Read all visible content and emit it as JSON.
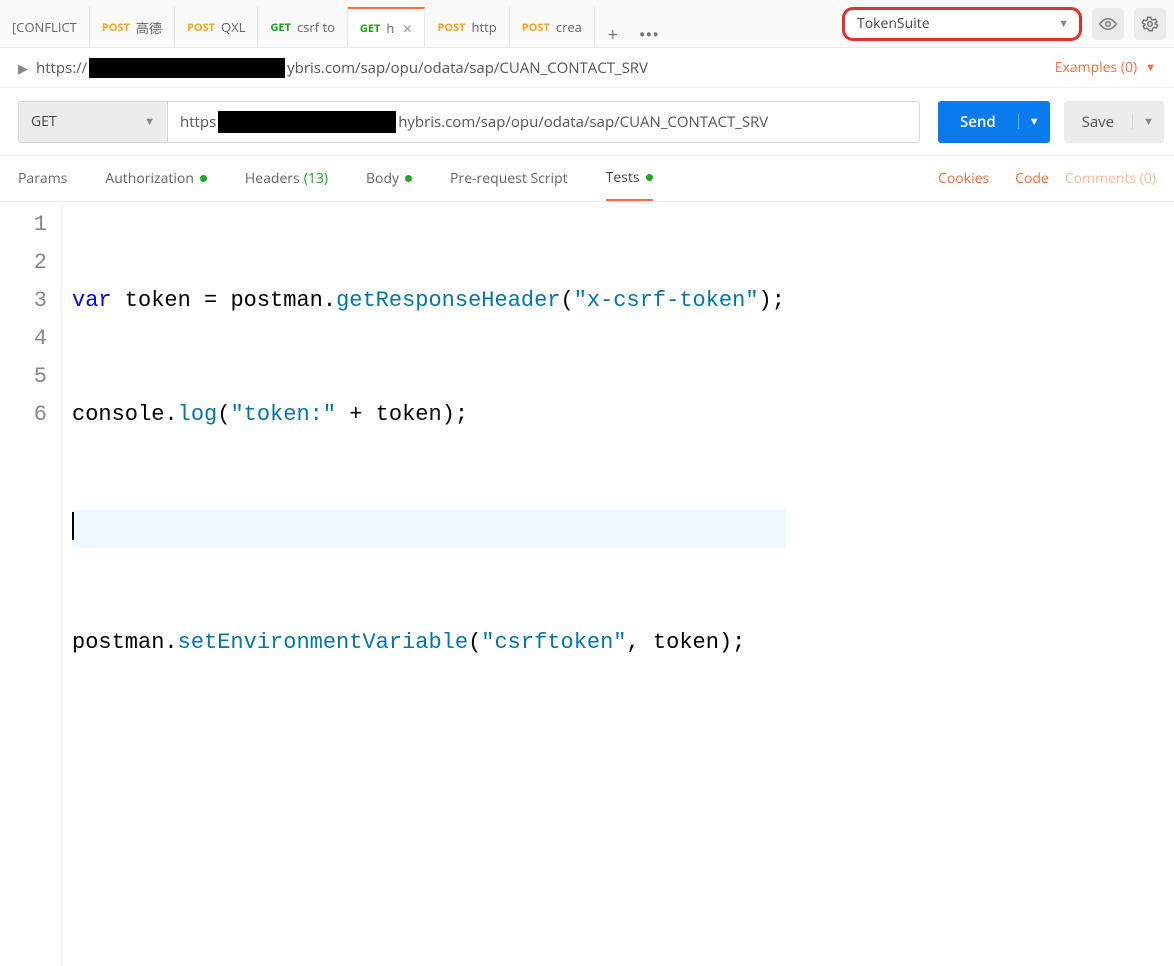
{
  "environment": {
    "selected": "TokenSuite"
  },
  "tabs": [
    {
      "method": "",
      "label": "[CONFLICT"
    },
    {
      "method": "POST",
      "label": "高德"
    },
    {
      "method": "POST",
      "label": "QXL"
    },
    {
      "method": "GET",
      "label": "csrf to"
    },
    {
      "method": "GET",
      "label": "h",
      "active": true,
      "closable": true
    },
    {
      "method": "POST",
      "label": "http"
    },
    {
      "method": "POST",
      "label": "crea"
    }
  ],
  "breadcrumb": {
    "prefix": "https://",
    "suffix": "ybris.com/sap/opu/odata/sap/CUAN_CONTACT_SRV"
  },
  "examples": {
    "label": "Examples (0)"
  },
  "request": {
    "method": "GET",
    "url_prefix": "https",
    "url_suffix": "hybris.com/sap/opu/odata/sap/CUAN_CONTACT_SRV",
    "send_label": "Send",
    "save_label": "Save"
  },
  "subtabs": {
    "params": "Params",
    "auth": "Authorization",
    "headers": "Headers",
    "headers_count": "(13)",
    "body": "Body",
    "prereq": "Pre-request Script",
    "tests": "Tests",
    "cookies": "Cookies",
    "code": "Code",
    "comments": "Comments (0)"
  },
  "editor": {
    "lines": [
      "1",
      "2",
      "3",
      "4",
      "5",
      "6"
    ],
    "code": {
      "l1": {
        "kw": "var",
        "v1": " token ",
        "eq": "= ",
        "obj": "postman",
        "dot": ".",
        "fn": "getResponseHeader",
        "open": "(",
        "str": "\"x-csrf-token\"",
        "close": ");"
      },
      "l2": {
        "obj": "console",
        "dot": ".",
        "fn": "log",
        "open": "(",
        "str": "\"token:\"",
        "plus": " + ",
        "v1": "token",
        "close": ");"
      },
      "l4": {
        "obj": "postman",
        "dot": ".",
        "fn": "setEnvironmentVariable",
        "open": "(",
        "str": "\"csrftoken\"",
        "comma": ", ",
        "v1": "token",
        "close": ");"
      }
    }
  }
}
